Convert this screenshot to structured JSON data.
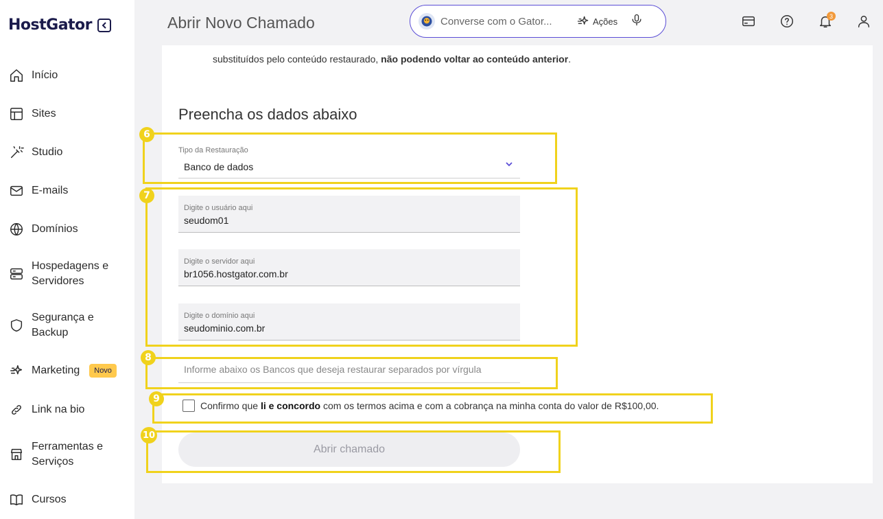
{
  "sidebar": {
    "logo": "HostGator",
    "items": [
      {
        "label": "Início",
        "icon": "home-icon"
      },
      {
        "label": "Sites",
        "icon": "layout-icon"
      },
      {
        "label": "Studio",
        "icon": "magic-wand-icon"
      },
      {
        "label": "E-mails",
        "icon": "mail-icon"
      },
      {
        "label": "Domínios",
        "icon": "globe-icon"
      },
      {
        "label": "Hospedagens e Servidores",
        "icon": "server-icon"
      },
      {
        "label": "Segurança e Backup",
        "icon": "shield-icon"
      },
      {
        "label": "Marketing",
        "icon": "sparkles-icon",
        "badge": "Novo"
      },
      {
        "label": "Link na bio",
        "icon": "link-icon"
      },
      {
        "label": "Ferramentas e Serviços",
        "icon": "store-icon"
      },
      {
        "label": "Cursos",
        "icon": "book-icon"
      }
    ]
  },
  "header": {
    "title": "Abrir Novo Chamado",
    "chat_placeholder": "Converse com o Gator...",
    "actions_label": "Ações",
    "notification_count": "3"
  },
  "main": {
    "intro_text": "substituídos pelo conteúdo restaurado,",
    "intro_bold": "não podendo voltar ao conteúdo anterior",
    "intro_end": ".",
    "section_title": "Preencha os dados abaixo",
    "restore_type": {
      "label": "Tipo da Restauração",
      "value": "Banco de dados"
    },
    "user_field": {
      "label": "Digite o usuário aqui",
      "value": "seudom01"
    },
    "server_field": {
      "label": "Digite o servidor aqui",
      "value": "br1056.hostgator.com.br"
    },
    "domain_field": {
      "label": "Digite o domínio aqui",
      "value": "seudominio.com.br"
    },
    "databases_placeholder": "Informe abaixo os Bancos que deseja restaurar separados por vírgula",
    "confirm": {
      "pre": "Confirmo que",
      "bold": "li e concordo",
      "post": "com os termos acima e com a cobrança na minha conta do valor de R$100,00."
    },
    "submit_label": "Abrir chamado"
  },
  "annotations": [
    "6",
    "7",
    "8",
    "9",
    "10"
  ],
  "colors": {
    "annotation": "#f0d21c",
    "accent": "#5a4dd6",
    "badge": "#ffc94d",
    "notification": "#f29a3b"
  }
}
